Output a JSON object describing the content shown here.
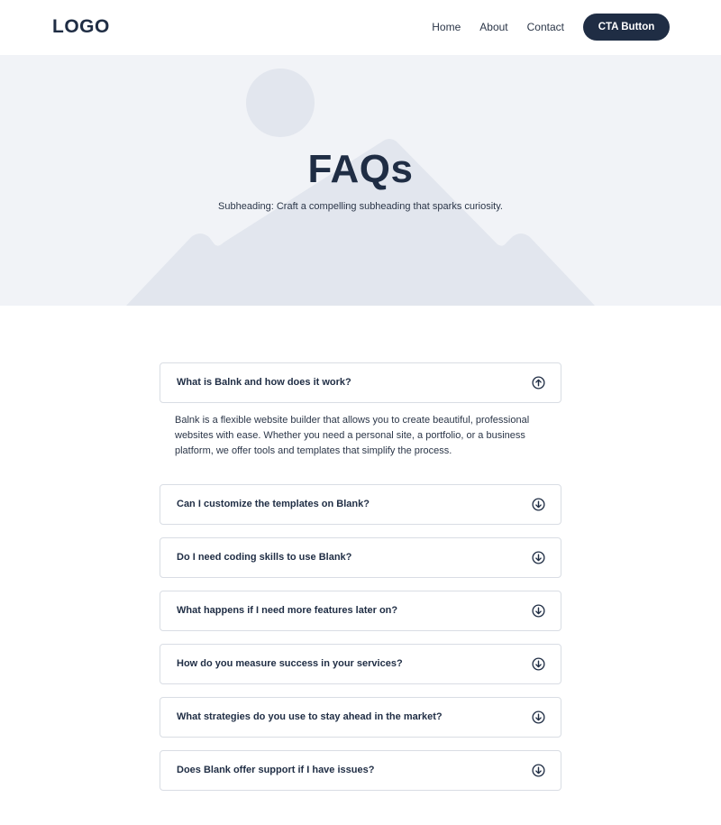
{
  "header": {
    "logo": "LOGO",
    "nav": [
      "Home",
      "About",
      "Contact"
    ],
    "cta_label": "CTA Button"
  },
  "hero": {
    "title": "FAQs",
    "subheading": "Subheading: Craft a compelling subheading that sparks curiosity."
  },
  "faq": {
    "items": [
      {
        "question": "What is Balnk and how does it work?",
        "expanded": true,
        "answer": "Balnk is a flexible website builder that allows you to create beautiful, professional websites with ease. Whether you need a personal site, a portfolio, or a business platform, we offer tools and templates that simplify the process."
      },
      {
        "question": "Can I customize the templates on Blank?",
        "expanded": false
      },
      {
        "question": "Do I need coding skills to use Blank?",
        "expanded": false
      },
      {
        "question": "What happens if I need more features later on?",
        "expanded": false
      },
      {
        "question": "How do you measure success in your services?",
        "expanded": false
      },
      {
        "question": "What strategies do you use to stay ahead in the market?",
        "expanded": false
      },
      {
        "question": "Does Blank offer support if I have issues?",
        "expanded": false
      }
    ]
  },
  "colors": {
    "primary": "#1f2d44",
    "hero_bg": "#f1f3f7",
    "illustration": "#e2e6ee",
    "border": "#d9dde4"
  }
}
